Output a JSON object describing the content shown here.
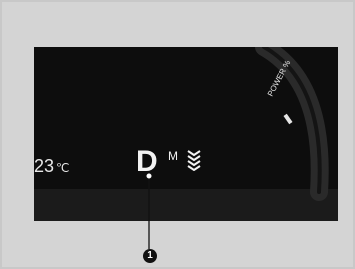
{
  "display": {
    "temperature": "23",
    "temperature_unit": "℃",
    "gear": "D",
    "gear_mode": "M",
    "power_label": "POWER %"
  },
  "callout": {
    "number": "1"
  }
}
